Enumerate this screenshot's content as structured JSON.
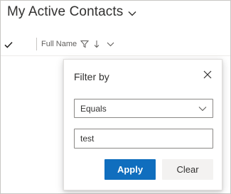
{
  "view": {
    "title": "My Active Contacts",
    "chevron_icon": "chevron-down-icon"
  },
  "grid": {
    "select_all_icon": "checkmark-icon",
    "column": {
      "label": "Full Name",
      "filter_icon": "filter-icon",
      "sort_icon": "arrow-down-icon",
      "menu_icon": "chevron-down-icon"
    }
  },
  "filter_panel": {
    "title": "Filter by",
    "close_icon": "close-icon",
    "operator": "Equals",
    "value": "test",
    "apply_label": "Apply",
    "clear_label": "Clear"
  },
  "colors": {
    "primary": "#106ebe",
    "secondary_bg": "#f3f2f1",
    "border": "#8a8886"
  }
}
